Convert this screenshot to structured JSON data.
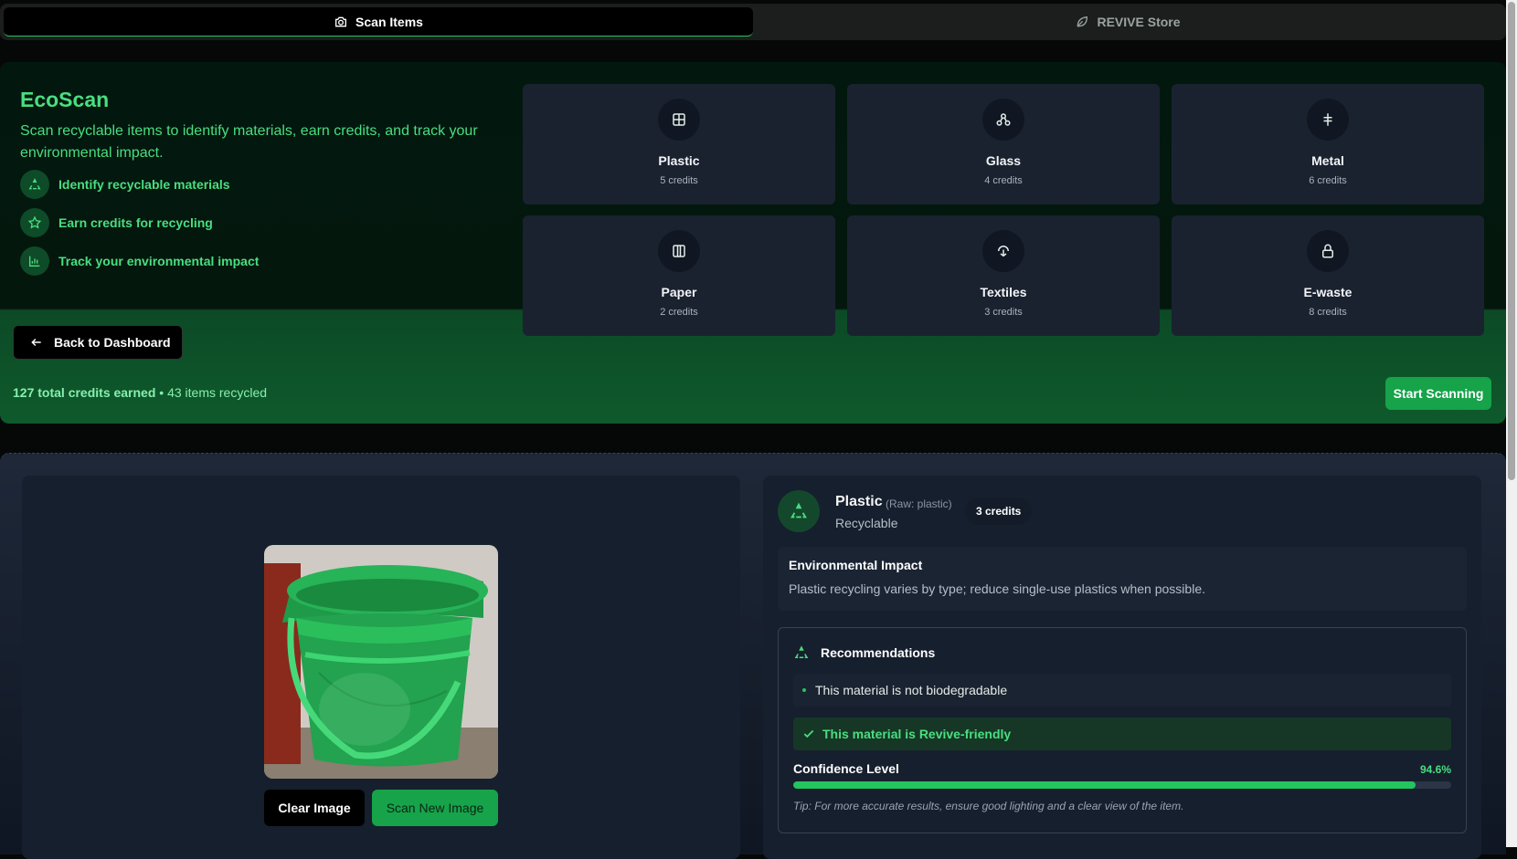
{
  "tabs": [
    {
      "label": "Scan Items",
      "icon": "camera-icon",
      "active": true
    },
    {
      "label": "REVIVE Store",
      "icon": "leaf-icon",
      "active": false
    }
  ],
  "hero": {
    "title": "EcoScan",
    "description": "Scan recyclable items to identify materials, earn credits, and track your environmental impact.",
    "features": [
      {
        "label": "Identify recyclable materials",
        "icon": "recycle-icon"
      },
      {
        "label": "Earn credits for recycling",
        "icon": "star-icon"
      },
      {
        "label": "Track your environmental impact",
        "icon": "bar-chart-icon"
      }
    ],
    "back_label": "Back to Dashboard",
    "credits_total": "127 total credits earned",
    "items_recycled": " • 43 items recycled",
    "start_label": "Start Scanning"
  },
  "materials": [
    {
      "name": "Plastic",
      "credits": "5 credits",
      "icon": "plastic-icon"
    },
    {
      "name": "Glass",
      "credits": "4 credits",
      "icon": "glass-icon"
    },
    {
      "name": "Metal",
      "credits": "6 credits",
      "icon": "metal-icon"
    },
    {
      "name": "Paper",
      "credits": "2 credits",
      "icon": "paper-icon"
    },
    {
      "name": "Textiles",
      "credits": "3 credits",
      "icon": "textiles-icon"
    },
    {
      "name": "E-waste",
      "credits": "8 credits",
      "icon": "ewaste-icon"
    }
  ],
  "scan": {
    "clear_label": "Clear Image",
    "new_label": "Scan New Image"
  },
  "result": {
    "name": "Plastic",
    "raw": "(Raw: plastic)",
    "status": "Recyclable",
    "credits": "3 credits",
    "env_title": "Environmental Impact",
    "env_desc": "Plastic recycling varies by type; reduce single-use plastics when possible.",
    "rec_title": "Recommendations",
    "rec_item": "This material is not biodegradable",
    "revive": "This material is Revive-friendly",
    "confidence_label": "Confidence Level",
    "confidence_text": "94.6%",
    "confidence": 0.946,
    "tip": "Tip: For more accurate results, ensure good lighting and a clear view of the item."
  },
  "colors": {
    "accent": "#22c55e",
    "accent_text": "#4ade80",
    "panel": "#161f2d"
  }
}
